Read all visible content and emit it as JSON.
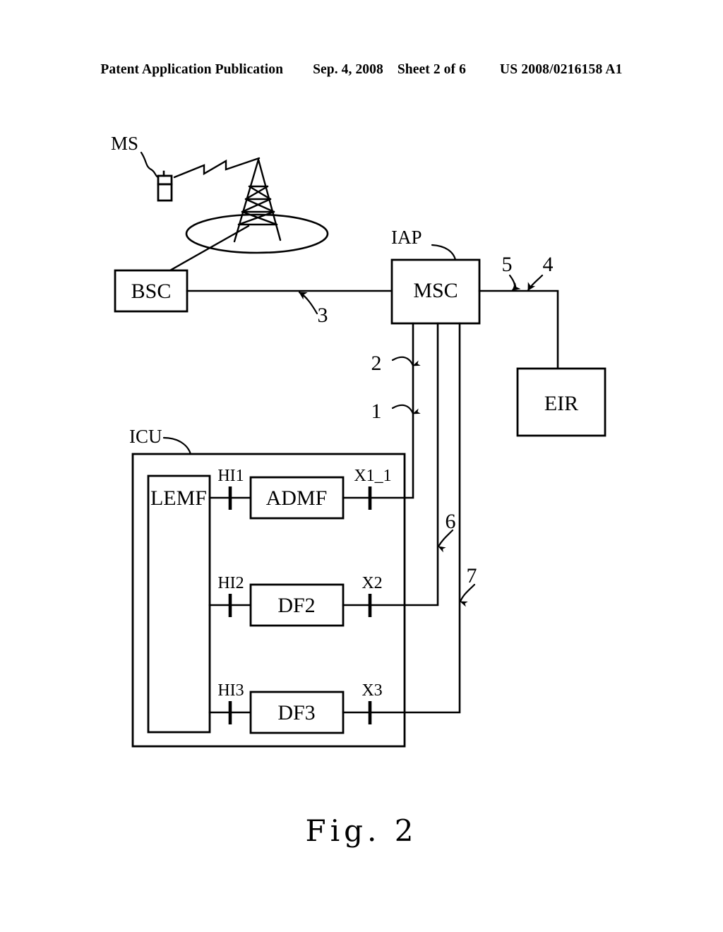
{
  "header": {
    "title": "Patent Application Publication",
    "date": "Sep. 4, 2008",
    "sheet": "Sheet 2 of 6",
    "pub_number": "US 2008/0216158 A1"
  },
  "figure": {
    "caption": "Fig. 2",
    "nodes": {
      "ms": "MS",
      "bsc": "BSC",
      "msc": "MSC",
      "eir": "EIR",
      "iap": "IAP",
      "icu": "ICU",
      "lemf": "LEMF",
      "admf": "ADMF",
      "df2": "DF2",
      "df3": "DF3"
    },
    "interfaces": {
      "hi1": "HI1",
      "hi2": "HI2",
      "hi3": "HI3",
      "x1_1": "X1_1",
      "x2": "X2",
      "x3": "X3"
    },
    "reference_numerals": {
      "n1": "1",
      "n2": "2",
      "n3": "3",
      "n4": "4",
      "n5": "5",
      "n6": "6",
      "n7": "7"
    },
    "colors": {
      "ink": "#000000",
      "paper": "#ffffff"
    }
  }
}
